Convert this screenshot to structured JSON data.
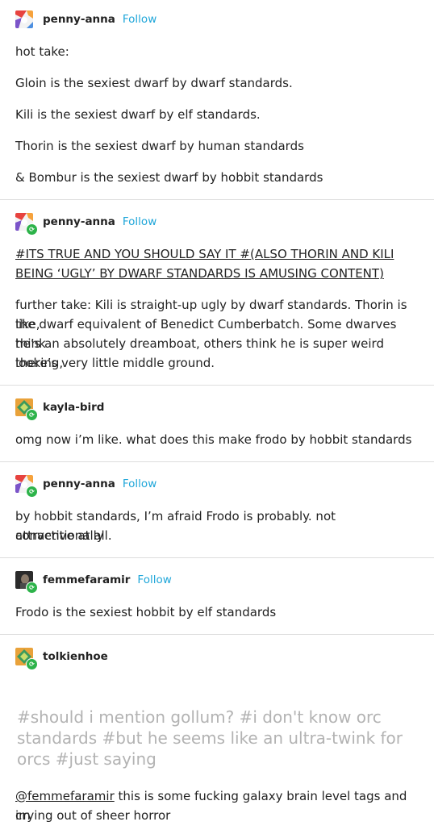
{
  "posts": [
    {
      "username": "penny-anna",
      "follow": "Follow",
      "avatar_icon": "penny-anna-avatar",
      "lines": [
        "hot take:",
        "Gloin is the sexiest dwarf by dwarf standards.",
        "Kili is the sexiest dwarf by elf standards.",
        "Thorin is the sexiest dwarf by human standards",
        "& Bombur is the sexiest dwarf by hobbit standards"
      ]
    },
    {
      "username": "penny-anna",
      "follow": "Follow",
      "reblog_icon": "reblog-icon",
      "tags_line1": "#ITS TRUE AND YOU SHOULD SAY IT #(ALSO THORIN AND KILI",
      "tags_line2": "BEING ‘UGLY’ BY DWARF STANDARDS IS AMUSING CONTENT)",
      "body_lines": [
        "further take: Kili is straight-up ugly by dwarf standards. Thorin is like,",
        "the dwarf equivalent of Benedict Cumberbatch. Some dwarves think",
        "he’s an absolutely dreamboat, others think he is super weird looking,",
        "there’s very little middle ground."
      ]
    },
    {
      "username": "kayla-bird",
      "body": "omg now i’m like. what does this make frodo by hobbit standards"
    },
    {
      "username": "penny-anna",
      "follow": "Follow",
      "body_lines": [
        "by hobbit standards, I’m afraid Frodo is probably. not conventionally",
        "attractive at all."
      ]
    },
    {
      "username": "femmefaramir",
      "follow": "Follow",
      "body": "Frodo is the sexiest hobbit by elf standards"
    },
    {
      "username": "tolkienhoe",
      "tag_lines": [
        "#should i mention gollum?  #i don't know orc",
        "standards  #but he seems like an ultra-twink for",
        "orcs  #just saying"
      ],
      "mention": "@femmefaramir",
      "reply_rest": " this is some fucking galaxy brain level tags and im",
      "reply_line2": "crying out of sheer horror"
    }
  ],
  "colors": {
    "follow": "#1fa6d9",
    "reblog": "#2db34a",
    "tags": "#b3b3b3",
    "separator": "#dddddd"
  }
}
